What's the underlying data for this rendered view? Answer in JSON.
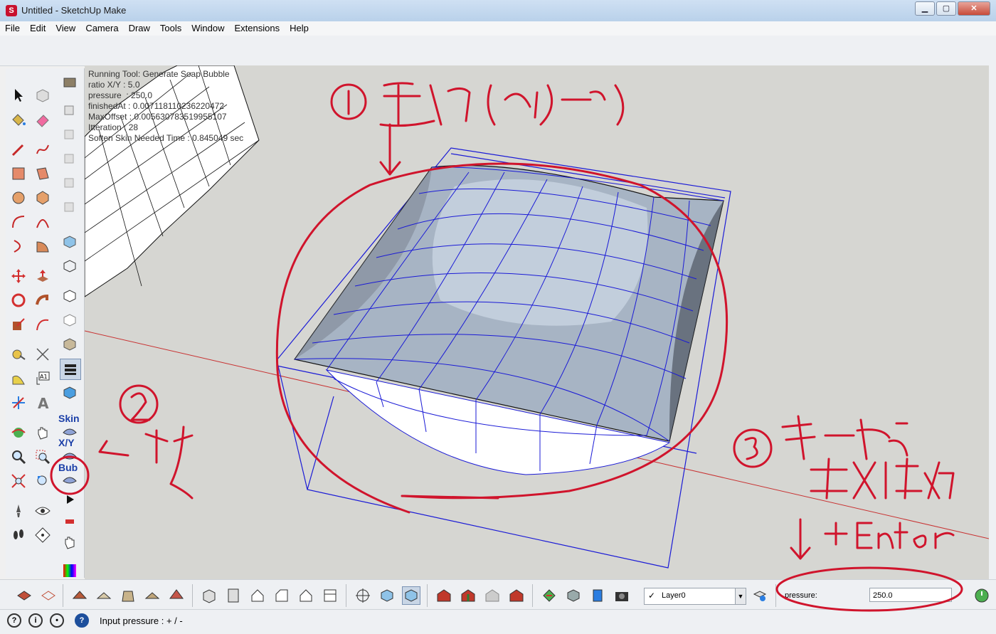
{
  "window": {
    "title": "Untitled - SketchUp Make",
    "minimize_icon": "minimize-icon",
    "maximize_icon": "maximize-icon",
    "close_icon": "close-icon"
  },
  "menu": [
    "File",
    "Edit",
    "View",
    "Camera",
    "Draw",
    "Tools",
    "Window",
    "Extensions",
    "Help"
  ],
  "plugin": {
    "skin_label": "Skin",
    "xy_label": "X/Y",
    "bubble_label": "Bub"
  },
  "viewport": {
    "info_lines": [
      "Running Tool: Generate Soap Bubble",
      "ratio X/Y : 5.0",
      "pressure  : 250.0",
      "finishedAt : 0.007118110236220472",
      "MaxOffset : 0.005630783519955107",
      "Itteration : 28",
      "Soften Skin Needed Time : 0.845049 sec"
    ]
  },
  "layer": {
    "name": "Layer0",
    "checked": "✓"
  },
  "vcb": {
    "label": "pressure:",
    "value": "250.0"
  },
  "status": {
    "text": "Input pressure : + / -"
  },
  "colors": {
    "edge_blue": "#1a1ad6",
    "annotation_red": "#d0142c",
    "axis_red": "#c83232"
  }
}
